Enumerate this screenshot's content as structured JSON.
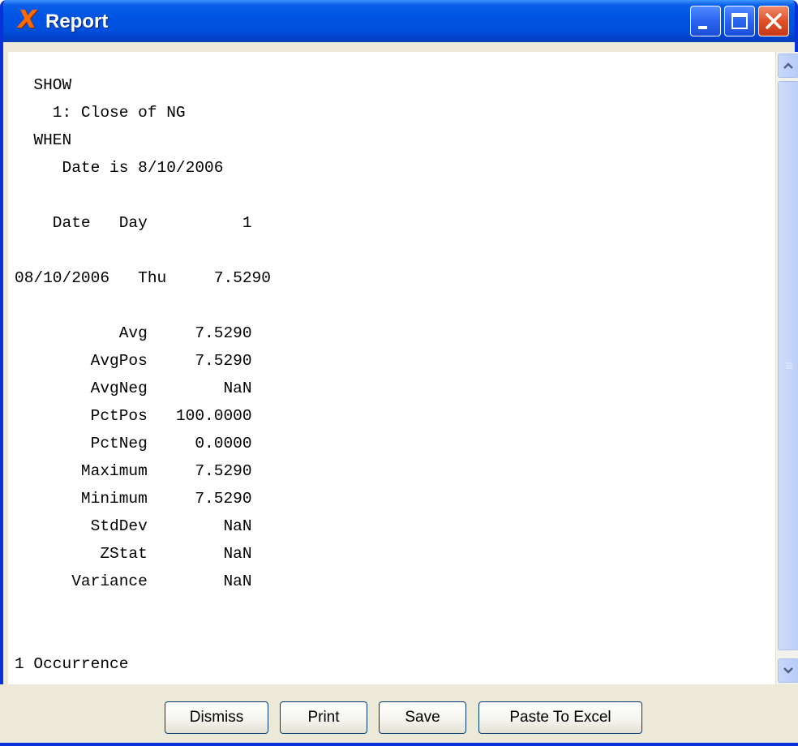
{
  "window": {
    "title": "Report",
    "icon": "x-app-icon"
  },
  "report": {
    "text": "  SHOW\n    1: Close of NG\n  WHEN\n     Date is 8/10/2006\n\n    Date   Day          1\n\n08/10/2006   Thu     7.5290\n\n           Avg     7.5290\n        AvgPos     7.5290\n        AvgNeg        NaN\n        PctPos   100.0000\n        PctNeg     0.0000\n       Maximum     7.5290\n       Minimum     7.5290\n        StdDev        NaN\n         ZStat        NaN\n      Variance        NaN\n\n\n1 Occurrence"
  },
  "buttons": {
    "dismiss": "Dismiss",
    "print": "Print",
    "save": "Save",
    "paste_to_excel": "Paste To Excel"
  },
  "colors": {
    "titlebar": "#0054e3",
    "window_border": "#0831d9",
    "close_button": "#e0502a",
    "face": "#ece9d8"
  }
}
